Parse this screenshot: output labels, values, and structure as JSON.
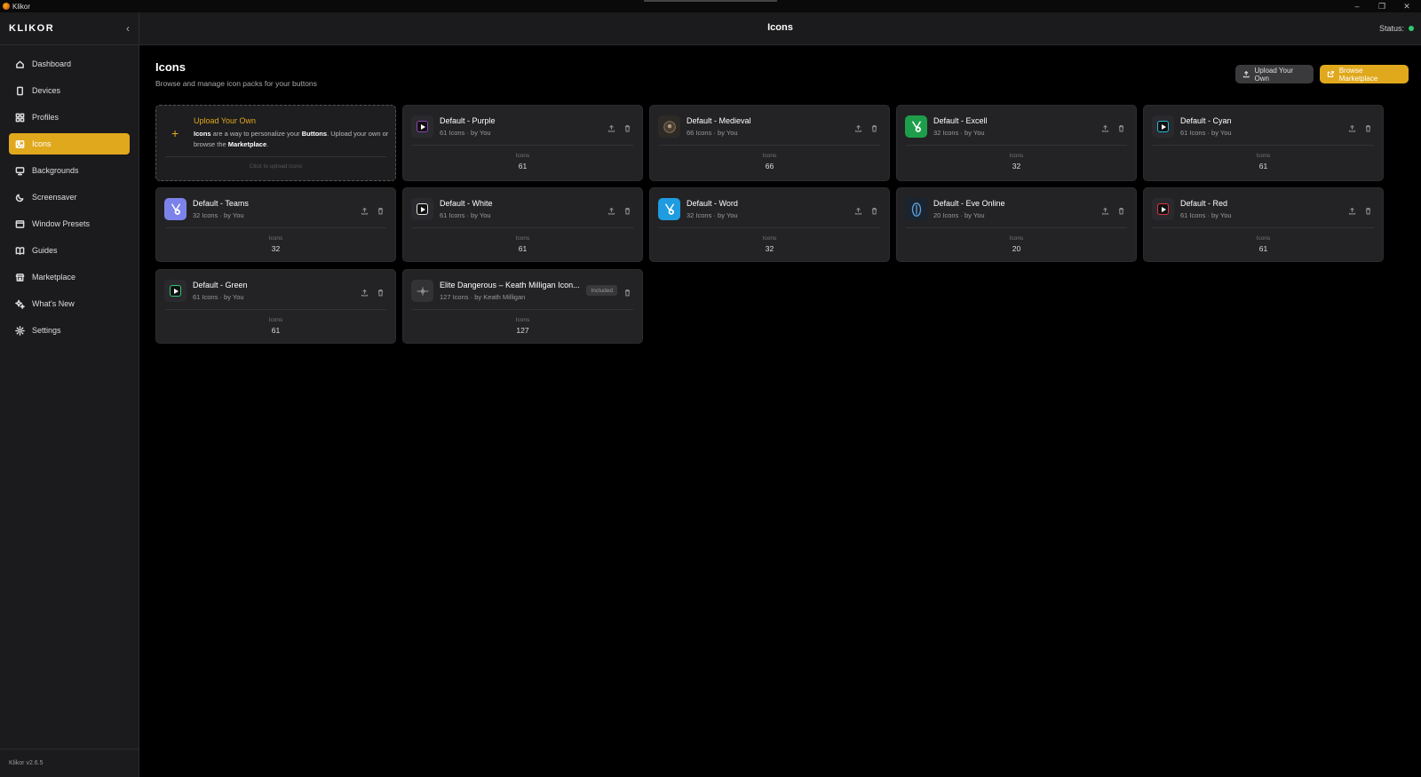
{
  "window": {
    "app_name": "Klikor",
    "minimize": "–",
    "restore": "❐",
    "close": "✕"
  },
  "sidebar": {
    "brand": "KLIKOR",
    "collapse_icon": "chevron-left-icon",
    "items": [
      {
        "label": "Dashboard",
        "icon": "home-icon"
      },
      {
        "label": "Devices",
        "icon": "device-icon"
      },
      {
        "label": "Profiles",
        "icon": "grid-icon"
      },
      {
        "label": "Icons",
        "icon": "image-icon",
        "active": true
      },
      {
        "label": "Backgrounds",
        "icon": "monitor-icon"
      },
      {
        "label": "Screensaver",
        "icon": "moon-icon"
      },
      {
        "label": "Window Presets",
        "icon": "window-icon"
      },
      {
        "label": "Guides",
        "icon": "book-icon"
      },
      {
        "label": "Marketplace",
        "icon": "store-icon"
      },
      {
        "label": "What's New",
        "icon": "sparkles-icon"
      },
      {
        "label": "Settings",
        "icon": "gear-icon"
      }
    ],
    "version": "Klikor v2.6.5"
  },
  "topbar": {
    "title": "Icons",
    "status_label": "Status:",
    "status_color": "#2ecc71"
  },
  "page": {
    "title": "Icons",
    "subtitle": "Browse and manage icon packs for your buttons",
    "upload_button": "Upload Your Own",
    "marketplace_button": "Browse Marketplace"
  },
  "upload_card": {
    "title": "Upload Your Own",
    "desc_1": "Icons",
    "desc_2": " are a way to personalize your ",
    "desc_3": "Buttons",
    "desc_4": ". Upload your own or browse the ",
    "desc_5": "Marketplace",
    "desc_6": ".",
    "hint": "Click to upload icons"
  },
  "stat_label": "Icons",
  "packs": [
    {
      "name": "Default - Purple",
      "meta": "61 Icons · by You",
      "count": "61",
      "color": "#8e44ad",
      "thumb_bg": "#2a2a2e"
    },
    {
      "name": "Default - Medieval",
      "meta": "66 Icons · by You",
      "count": "66",
      "color": "#7a6a55",
      "thumb_bg": "#2e2a26"
    },
    {
      "name": "Default - Excell",
      "meta": "32 Icons · by You",
      "count": "32",
      "color": "#1e9e4a",
      "thumb_bg": "#1e9e4a"
    },
    {
      "name": "Default - Cyan",
      "meta": "61 Icons · by You",
      "count": "61",
      "color": "#2bb7d6",
      "thumb_bg": "#2a2a2e"
    },
    {
      "name": "Default - Teams",
      "meta": "32 Icons · by You",
      "count": "32",
      "color": "#7b83eb",
      "thumb_bg": "#7b83eb"
    },
    {
      "name": "Default - White",
      "meta": "61 Icons · by You",
      "count": "61",
      "color": "#e6e6e6",
      "thumb_bg": "#2a2a2e"
    },
    {
      "name": "Default - Word",
      "meta": "32 Icons · by You",
      "count": "32",
      "color": "#1f9be0",
      "thumb_bg": "#1f9be0"
    },
    {
      "name": "Default - Eve Online",
      "meta": "20 Icons · by You",
      "count": "20",
      "color": "#3b7bbf",
      "thumb_bg": "#1a2430"
    },
    {
      "name": "Default - Red",
      "meta": "61 Icons · by You",
      "count": "61",
      "color": "#e0333a",
      "thumb_bg": "#2a2a2e"
    },
    {
      "name": "Default - Green",
      "meta": "61 Icons · by You",
      "count": "61",
      "color": "#2ecc71",
      "thumb_bg": "#2a2a2e"
    },
    {
      "name": "Elite Dangerous – Keath Milligan Icon...",
      "meta": "127 Icons · by Keath Milligan",
      "count": "127",
      "color": "#888888",
      "thumb_bg": "#333336",
      "badge": "Included"
    }
  ]
}
